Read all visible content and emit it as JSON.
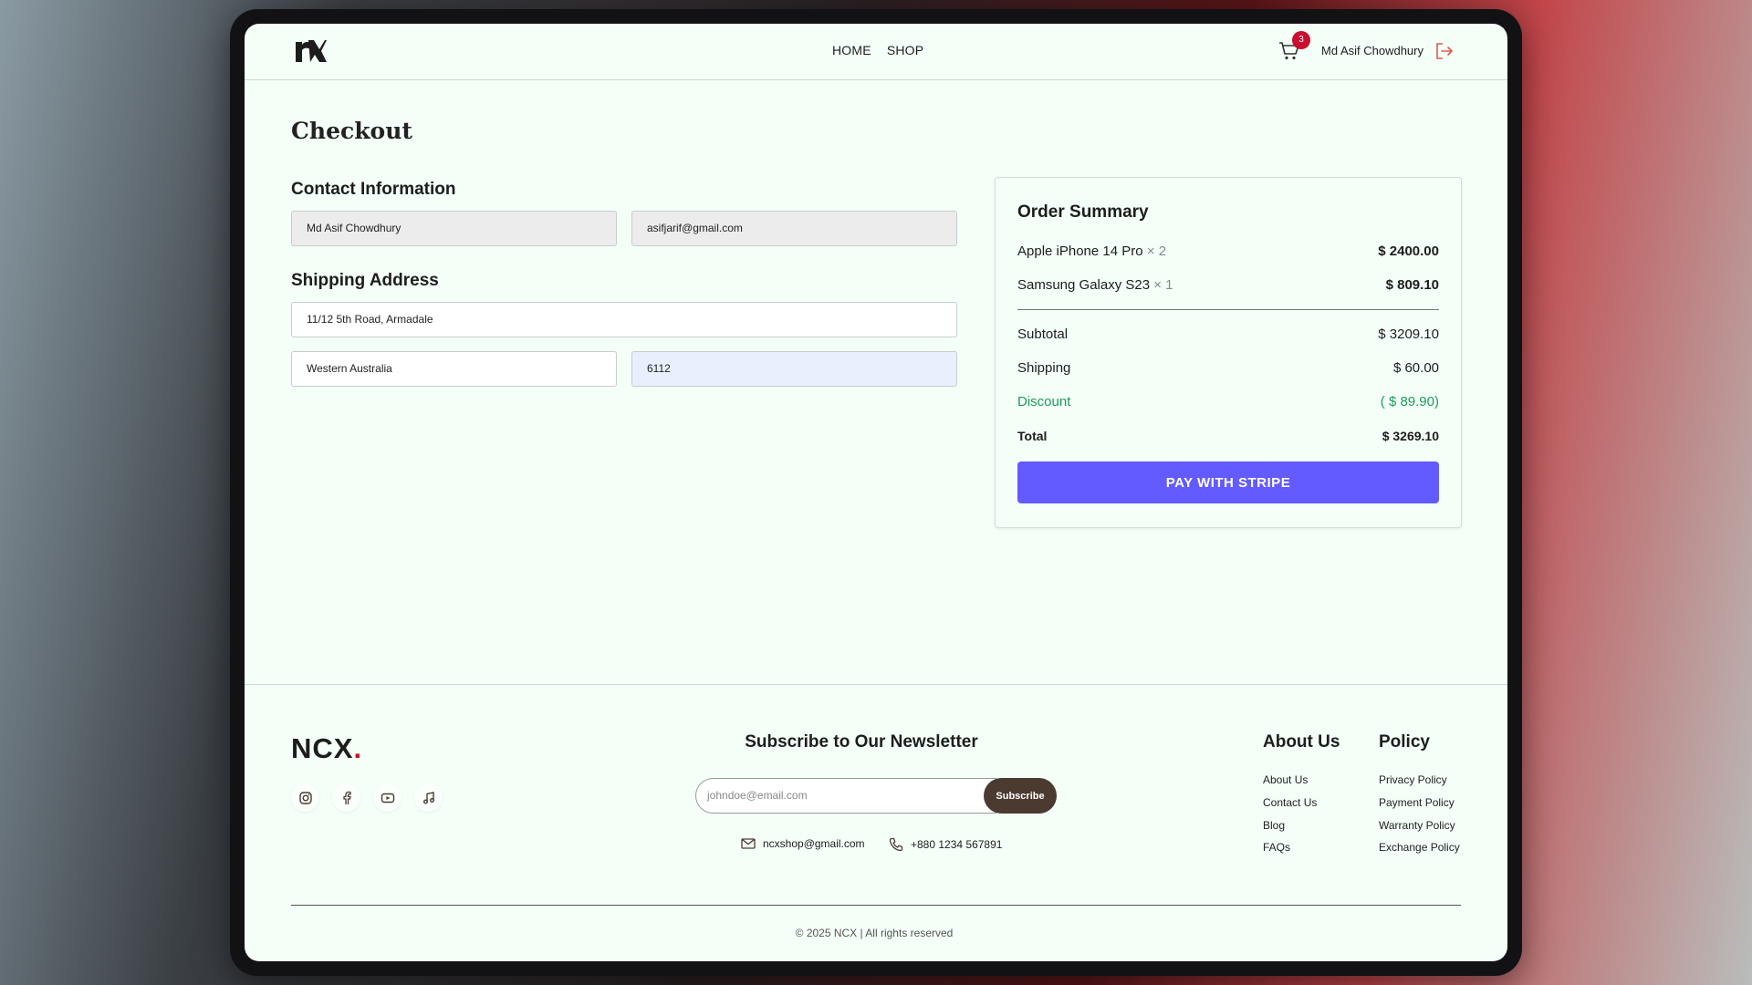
{
  "header": {
    "logo_text": "nx",
    "nav": [
      "HOME",
      "SHOP"
    ],
    "cart_count": "3",
    "user_name": "Md Asif Chowdhury"
  },
  "checkout": {
    "title": "Checkout",
    "contact_title": "Contact Information",
    "name_value": "Md Asif Chowdhury",
    "email_value": "asifjarif@gmail.com",
    "shipping_title": "Shipping Address",
    "address_value": "11/12 5th Road, Armadale",
    "state_value": "Western Australia",
    "postcode_value": "6112"
  },
  "summary": {
    "title": "Order Summary",
    "items": [
      {
        "name": "Apple iPhone 14 Pro",
        "qty": "× 2",
        "price": "$ 2400.00"
      },
      {
        "name": "Samsung Galaxy S23",
        "qty": "× 1",
        "price": "$ 809.10"
      }
    ],
    "subtotal_label": "Subtotal",
    "subtotal_value": "$ 3209.10",
    "shipping_label": "Shipping",
    "shipping_value": "$ 60.00",
    "discount_label": "Discount",
    "discount_value": "( $ 89.90)",
    "total_label": "Total",
    "total_value": "$ 3269.10",
    "pay_label": "PAY WITH STRIPE"
  },
  "footer": {
    "brand": "NCX",
    "brand_dot": ".",
    "newsletter_title": "Subscribe to Our Newsletter",
    "newsletter_placeholder": "johndoe@email.com",
    "subscribe_label": "Subscribe",
    "email": "ncxshop@gmail.com",
    "phone": "+880 1234 567891",
    "about_title": "About Us",
    "about_links": [
      "About Us",
      "Contact Us",
      "Blog",
      "FAQs"
    ],
    "policy_title": "Policy",
    "policy_links": [
      "Privacy Policy",
      "Payment Policy",
      "Warranty Policy",
      "Exchange Policy"
    ],
    "copyright": "© 2025 NCX | All rights reserved"
  },
  "colors": {
    "accent": "#635bff",
    "badge": "#c8102e",
    "discount": "#1f9a5a",
    "subscribe": "#4a3a30",
    "page_bg": "#f4fff8"
  }
}
